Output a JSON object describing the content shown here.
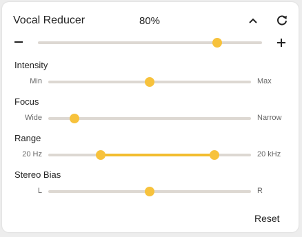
{
  "header": {
    "title": "Vocal Reducer",
    "amount": "80%",
    "amount_value": 0.8
  },
  "controls": [
    {
      "label": "Intensity",
      "min_label": "Min",
      "max_label": "Max",
      "value": 0.5
    },
    {
      "label": "Focus",
      "min_label": "Wide",
      "max_label": "Narrow",
      "value": 0.13
    },
    {
      "label": "Range",
      "min_label": "20 Hz",
      "max_label": "20 kHz",
      "low": 0.26,
      "high": 0.82
    },
    {
      "label": "Stereo Bias",
      "min_label": "L",
      "max_label": "R",
      "value": 0.5
    }
  ],
  "reset_label": "Reset",
  "colors": {
    "accent": "#f7c23c",
    "track": "#ddd8d2"
  },
  "icons": [
    "chevron-up-icon",
    "refresh-icon",
    "minus-icon",
    "plus-icon"
  ]
}
